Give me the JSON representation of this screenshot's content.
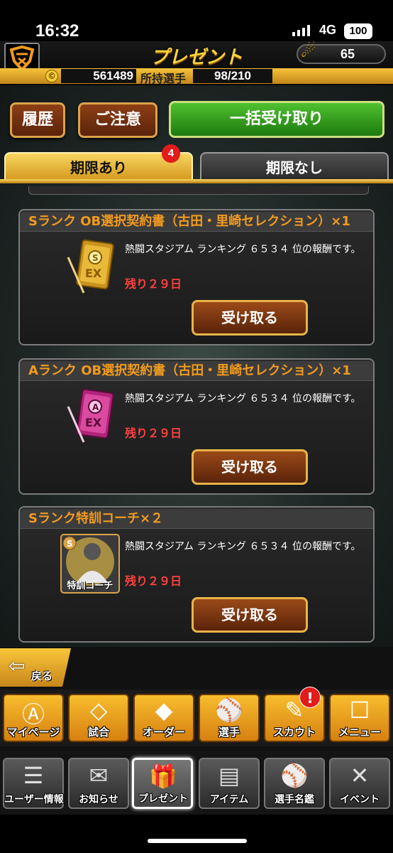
{
  "status_bar": {
    "time": "16:32",
    "network": "4G",
    "battery": "100"
  },
  "header": {
    "title": "プレゼント",
    "ticket_count": "65"
  },
  "info": {
    "coins": "561489",
    "players_label": "所持選手",
    "players": "98/210"
  },
  "actions": {
    "history": "履歴",
    "notice": "ご注意",
    "receive_all": "一括受け取り"
  },
  "tabs": [
    {
      "label": "期限あり",
      "badge": "4",
      "active": true
    },
    {
      "label": "期限なし",
      "active": false
    }
  ],
  "presents": [
    {
      "title": "Sランク OB選択契約書（古田・里崎セレクション）×1",
      "description": "熱闘スタジアム ランキング ６５３４ 位の報酬です。",
      "remaining": "残り２９日",
      "receive_label": "受け取る",
      "icon": "gold-contract-icon"
    },
    {
      "title": "Aランク OB選択契約書（古田・里崎セレクション）×1",
      "description": "熱闘スタジアム ランキング ６５３４ 位の報酬です。",
      "remaining": "残り２９日",
      "receive_label": "受け取る",
      "icon": "pink-contract-icon"
    },
    {
      "title": "Sランク特訓コーチ×２",
      "description": "熱闘スタジアム ランキング ６５３４ 位の報酬です。",
      "remaining": "残り２９日",
      "receive_label": "受け取る",
      "icon": "coach-icon",
      "icon_caption": "特訓コーチ"
    }
  ],
  "back_label": "戻る",
  "main_nav": [
    {
      "label": "マイページ",
      "icon": "mypage-icon"
    },
    {
      "label": "試合",
      "icon": "stadium-icon"
    },
    {
      "label": "オーダー",
      "icon": "order-icon"
    },
    {
      "label": "選手",
      "icon": "player-icon"
    },
    {
      "label": "スカウト",
      "icon": "scout-icon",
      "alert": "!"
    },
    {
      "label": "メニュー",
      "icon": "menu-icon"
    }
  ],
  "sub_nav": [
    {
      "label": "ユーザー情報",
      "icon": "user-info-icon"
    },
    {
      "label": "お知らせ",
      "icon": "news-icon"
    },
    {
      "label": "プレゼント",
      "icon": "present-icon",
      "active": true
    },
    {
      "label": "アイテム",
      "icon": "item-icon"
    },
    {
      "label": "選手名鑑",
      "icon": "directory-icon"
    },
    {
      "label": "イベント",
      "icon": "event-icon"
    }
  ],
  "colors": {
    "accent_gold": "#f7d23a",
    "title_orange": "#f29b1e",
    "remaining_red": "#ff4040",
    "green_button": "#36a01f"
  }
}
